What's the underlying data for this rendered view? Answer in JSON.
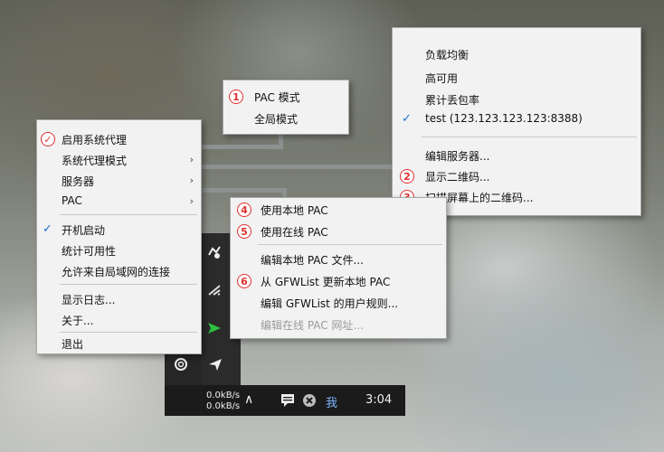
{
  "main_menu": {
    "items": [
      {
        "label": "启用系统代理",
        "badge_check": true
      },
      {
        "label": "系统代理模式",
        "submenu": true
      },
      {
        "label": "服务器",
        "submenu": true
      },
      {
        "label": "PAC",
        "submenu": true
      },
      {
        "label": "开机启动",
        "checked": true
      },
      {
        "label": "统计可用性"
      },
      {
        "label": "允许来自局域网的连接"
      },
      {
        "label": "显示日志..."
      },
      {
        "label": "关于..."
      },
      {
        "label": "退出"
      }
    ]
  },
  "proxy_mode_menu": {
    "items": [
      {
        "label": "PAC 模式",
        "badge": "1"
      },
      {
        "label": "全局模式"
      }
    ]
  },
  "server_menu": {
    "items": [
      {
        "label": "负载均衡"
      },
      {
        "label": "高可用"
      },
      {
        "label": "累计丢包率"
      },
      {
        "label": "test (123.123.123.123:8388)",
        "checked": true
      },
      {
        "label": "编辑服务器..."
      },
      {
        "label": "显示二维码...",
        "badge": "2"
      },
      {
        "label": "扫描屏幕上的二维码...",
        "badge": "3"
      }
    ]
  },
  "pac_menu": {
    "items": [
      {
        "label": "使用本地 PAC",
        "badge": "4"
      },
      {
        "label": "使用在线 PAC",
        "badge": "5"
      },
      {
        "label": "编辑本地 PAC 文件..."
      },
      {
        "label": "从 GFWList 更新本地 PAC",
        "badge": "6"
      },
      {
        "label": "编辑 GFWList 的用户规则..."
      },
      {
        "label": "编辑在线 PAC 网址...",
        "disabled": true
      }
    ]
  },
  "taskbar": {
    "upload_speed": "0.0kB/s",
    "download_speed": "0.0kB/s",
    "time": "3:04",
    "expand_glyph": "∧",
    "ime_glyph": "我"
  },
  "icons": [
    "shadowsocks-icon",
    "wifi-icon",
    "send-icon",
    "at-icon",
    "paper-plane-icon",
    "message-icon",
    "close-circle-icon",
    "ime-icon"
  ],
  "colors": {
    "menu_bg": "#f2f2f2",
    "badge_red": "#e0302f",
    "check_blue": "#1f6fd1",
    "taskbar_bg": "#1b1b1b"
  }
}
